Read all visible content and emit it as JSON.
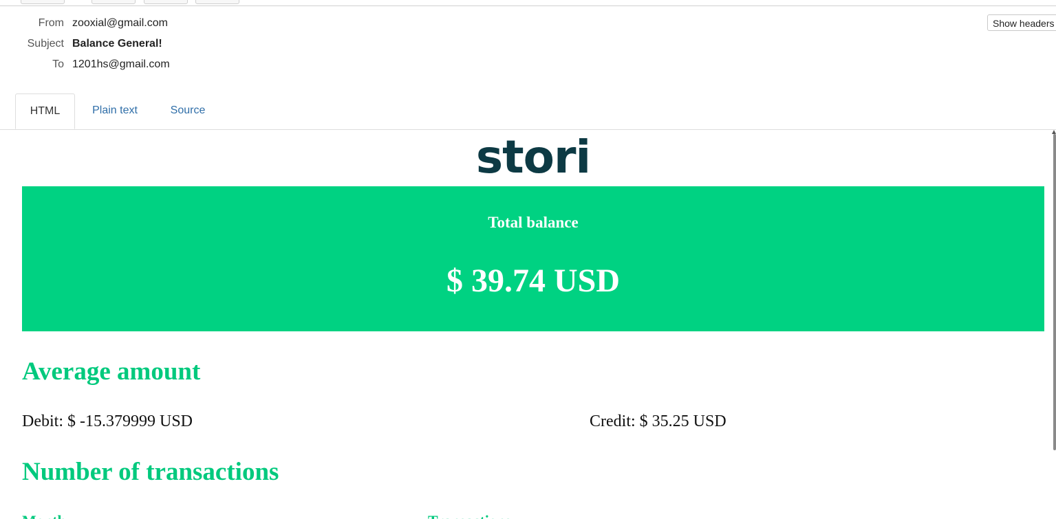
{
  "email_header": {
    "from_label": "From",
    "from_value": "zooxial@gmail.com",
    "subject_label": "Subject",
    "subject_value": "Balance General!",
    "to_label": "To",
    "to_value": "1201hs@gmail.com",
    "show_headers_label": "Show headers"
  },
  "tabs": [
    {
      "label": "HTML",
      "active": true
    },
    {
      "label": "Plain text",
      "active": false
    },
    {
      "label": "Source",
      "active": false
    }
  ],
  "email_body": {
    "logo_text": "stori",
    "balance": {
      "label": "Total balance",
      "amount": "$ 39.74 USD"
    },
    "average_heading": "Average amount",
    "debit_text": "Debit: $ -15.379999 USD",
    "credit_text": "Credit: $ 35.25 USD",
    "transactions_heading": "Number of transactions",
    "table_columns": [
      "Month",
      "Transactions"
    ]
  },
  "colors": {
    "brand_green": "#00d282",
    "heading_green": "#00c97d",
    "logo_dark": "#0d3a44",
    "link_blue": "#2f6ea8"
  }
}
